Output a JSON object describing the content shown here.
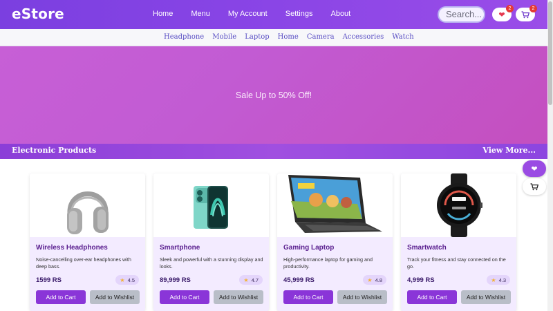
{
  "header": {
    "logo": "eStore",
    "nav": [
      "Home",
      "Menu",
      "My Account",
      "Settings",
      "About"
    ],
    "search_placeholder": "Search...",
    "wishlist_count": "2",
    "cart_count": "2"
  },
  "categories": [
    "Headphone",
    "Mobile",
    "Laptop",
    "Home",
    "Camera",
    "Accessories",
    "Watch"
  ],
  "hero": {
    "text": "Sale Up to 50% Off!"
  },
  "section": {
    "title": "Electronic Products",
    "view_more": "View More..."
  },
  "products": [
    {
      "name": "Wireless Headphones",
      "description": "Noise-cancelling over-ear headphones with deep bass.",
      "price": "1599 RS",
      "rating": "4.5",
      "add_to_cart": "Add to Cart",
      "add_to_wishlist": "Add to Wishlist"
    },
    {
      "name": "Smartphone",
      "description": "Sleek and powerful with a stunning display and looks.",
      "price": "89,999 RS",
      "rating": "4.7",
      "add_to_cart": "Add to Cart",
      "add_to_wishlist": "Add to Wishlist"
    },
    {
      "name": "Gaming Laptop",
      "description": "High-performance laptop for gaming and productivity.",
      "price": "45,999 RS",
      "rating": "4.8",
      "add_to_cart": "Add to Cart",
      "add_to_wishlist": "Add to Wishlist"
    },
    {
      "name": "Smartwatch",
      "description": "Track your fitness and stay connected on the go.",
      "price": "4,999 RS",
      "rating": "4.3",
      "add_to_cart": "Add to Cart",
      "add_to_wishlist": "Add to Wishlist"
    }
  ],
  "colors": {
    "header_gradient_start": "#7b3fe0",
    "hero_color": "#c75fd6",
    "accent": "#8a35d8",
    "badge": "#e53935"
  },
  "icons": {
    "wishlist": "heart-icon",
    "cart": "cart-icon",
    "rating": "star-icon"
  }
}
